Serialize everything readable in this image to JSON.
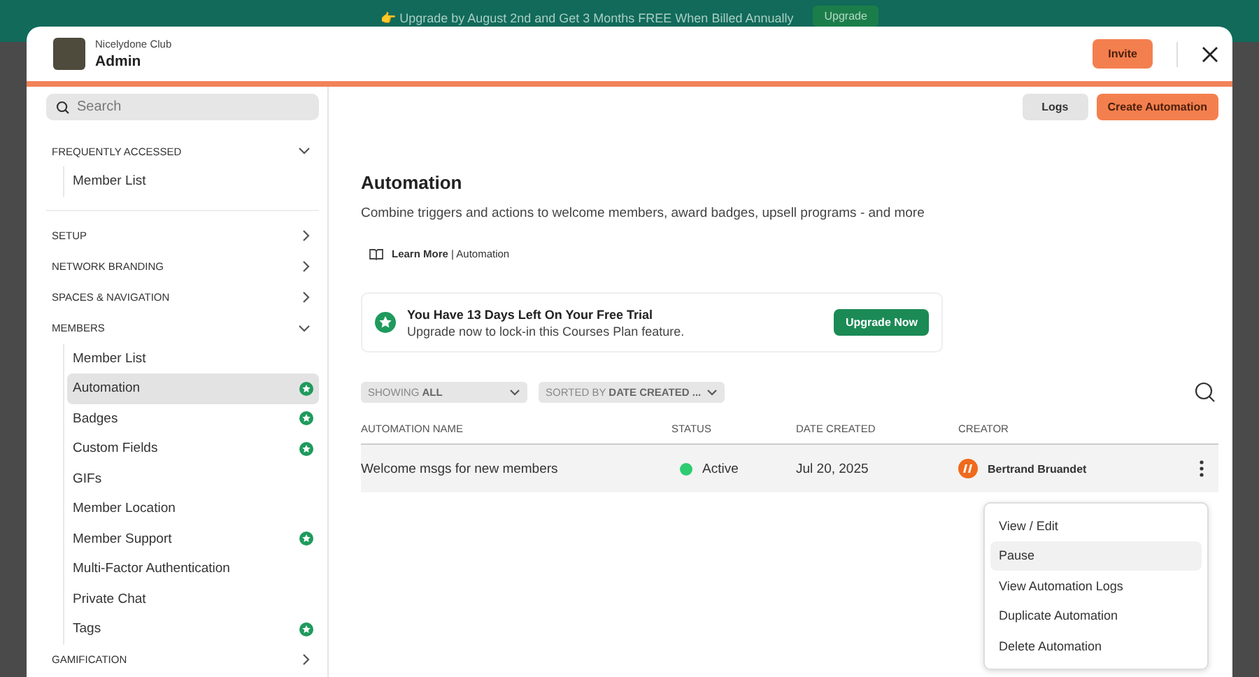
{
  "banner": {
    "text": "👉 Upgrade by August 2nd and Get 3 Months FREE When Billed Annually",
    "button": "Upgrade"
  },
  "header": {
    "org_name": "Nicelydone Club",
    "title": "Admin",
    "invite_button": "Invite"
  },
  "sidebar": {
    "search": {
      "placeholder": "Search"
    },
    "sections": [
      {
        "label": "FREQUENTLY ACCESSED",
        "expanded": true,
        "items": [
          {
            "label": "Member List",
            "selected": false,
            "premium": false
          }
        ]
      },
      {
        "label": "SETUP",
        "expanded": false
      },
      {
        "label": "NETWORK BRANDING",
        "expanded": false
      },
      {
        "label": "SPACES & NAVIGATION",
        "expanded": false
      },
      {
        "label": "MEMBERS",
        "expanded": true,
        "items": [
          {
            "label": "Member List",
            "selected": false,
            "premium": false
          },
          {
            "label": "Automation",
            "selected": true,
            "premium": true
          },
          {
            "label": "Badges",
            "selected": false,
            "premium": true
          },
          {
            "label": "Custom Fields",
            "selected": false,
            "premium": true
          },
          {
            "label": "GIFs",
            "selected": false,
            "premium": false
          },
          {
            "label": "Member Location",
            "selected": false,
            "premium": false
          },
          {
            "label": "Member Support",
            "selected": false,
            "premium": true
          },
          {
            "label": "Multi-Factor Authentication",
            "selected": false,
            "premium": false
          },
          {
            "label": "Private Chat",
            "selected": false,
            "premium": false
          },
          {
            "label": "Tags",
            "selected": false,
            "premium": true
          }
        ]
      },
      {
        "label": "GAMIFICATION",
        "expanded": false
      }
    ]
  },
  "main": {
    "toolbar": [
      {
        "label": "Logs",
        "kind": "secondary"
      },
      {
        "label": "Create Automation",
        "kind": "primary"
      }
    ],
    "title": "Automation",
    "description": "Combine triggers and actions to welcome members, award badges, upsell programs - and more",
    "learn_more": "**Learn More** | Automation",
    "trial": {
      "title": "You Have 13 Days Left On Your Free Trial",
      "subtitle": "Upgrade now to lock-in this Courses Plan feature.",
      "button": "Upgrade Now"
    },
    "filters": [
      "SHOWING **ALL**",
      "SORTED BY **DATE CREATED ...**"
    ],
    "table": {
      "columns": [
        "AUTOMATION NAME",
        "STATUS",
        "DATE CREATED",
        "CREATOR"
      ],
      "rows": [
        {
          "name": "Welcome msgs for new members",
          "status": "Active",
          "active": true,
          "date": "Jul 20, 2025",
          "creator": "Bertrand Bruandet",
          "selected": true
        }
      ]
    },
    "row_menu": [
      {
        "label": "View / Edit",
        "selected": false
      },
      {
        "label": "Pause",
        "selected": true
      },
      {
        "label": "View Automation Logs",
        "selected": false
      },
      {
        "label": "Duplicate Automation",
        "selected": false
      },
      {
        "label": "Delete Automation",
        "selected": false
      }
    ]
  }
}
